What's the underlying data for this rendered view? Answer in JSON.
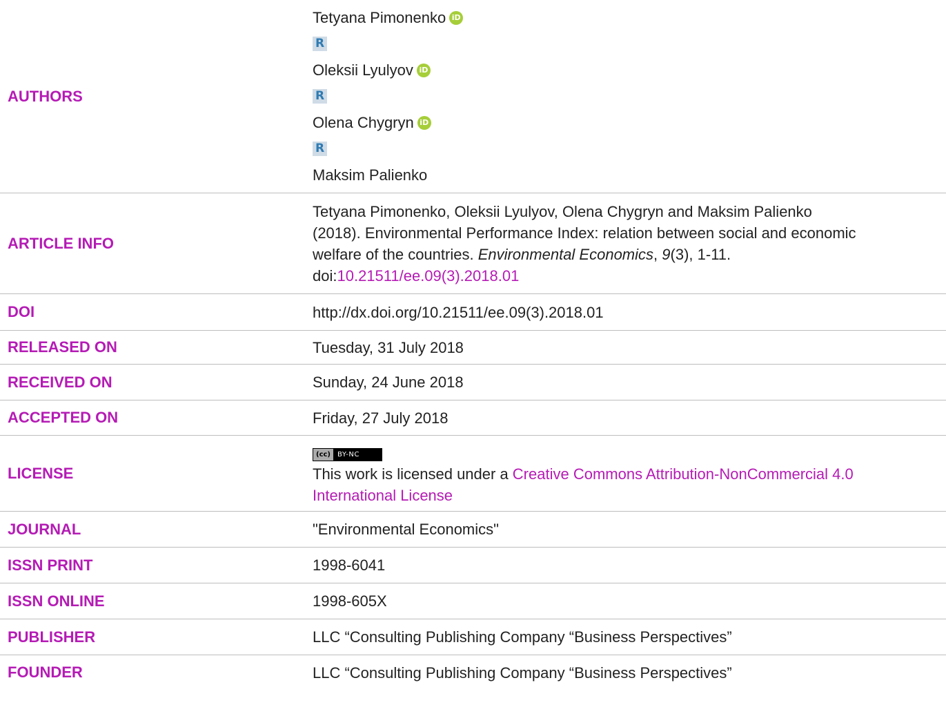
{
  "rows": {
    "authors": {
      "label": "AUTHORS",
      "names": [
        "Tetyana Pimonenko",
        "Oleksii Lyulyov",
        "Olena Chygryn",
        "Maksim Palienko"
      ],
      "orcid_glyph": "iD",
      "rg_glyph": "R"
    },
    "article_info": {
      "label": "ARTICLE INFO",
      "line1": "Tetyana Pimonenko, Oleksii Lyulyov, Olena Chygryn and Maksim Palienko",
      "line2": "(2018). Environmental Performance Index: relation between social and economic",
      "line3_pre": "welfare of the countries. ",
      "journal": "Environmental Economics",
      "sep": ", ",
      "volume": "9",
      "rest": "(3), 1-11.",
      "doi_prefix": "doi:",
      "doi_link": "10.21511/ee.09(3).2018.01"
    },
    "doi": {
      "label": "DOI",
      "value": "http://dx.doi.org/10.21511/ee.09(3).2018.01"
    },
    "released": {
      "label": "RELEASED ON",
      "value": "Tuesday, 31 July 2018"
    },
    "received": {
      "label": "RECEIVED ON",
      "value": "Sunday, 24 June 2018"
    },
    "accepted": {
      "label": "ACCEPTED ON",
      "value": "Friday, 27 July 2018"
    },
    "license": {
      "label": "LICENSE",
      "badge_left": "(cc)",
      "badge_right": "BY-NC",
      "text_pre": "This work is licensed under a ",
      "link_line1": "Creative Commons Attribution-NonCommercial 4.0",
      "link_line2": "International License"
    },
    "journal": {
      "label": "JOURNAL",
      "value": "\"Environmental Economics\""
    },
    "issn_print": {
      "label": "ISSN PRINT",
      "value": "1998-6041"
    },
    "issn_online": {
      "label": "ISSN ONLINE",
      "value": "1998-605X"
    },
    "publisher": {
      "label": "PUBLISHER",
      "value": "LLC “Consulting Publishing Company “Business Perspectives”"
    },
    "founder": {
      "label": "FOUNDER",
      "value": "LLC “Consulting Publishing Company “Business Perspectives”"
    }
  },
  "colors": {
    "label": "#b51bb5",
    "link": "#b51bb5",
    "orcid": "#a6ce39",
    "text": "#222222"
  }
}
